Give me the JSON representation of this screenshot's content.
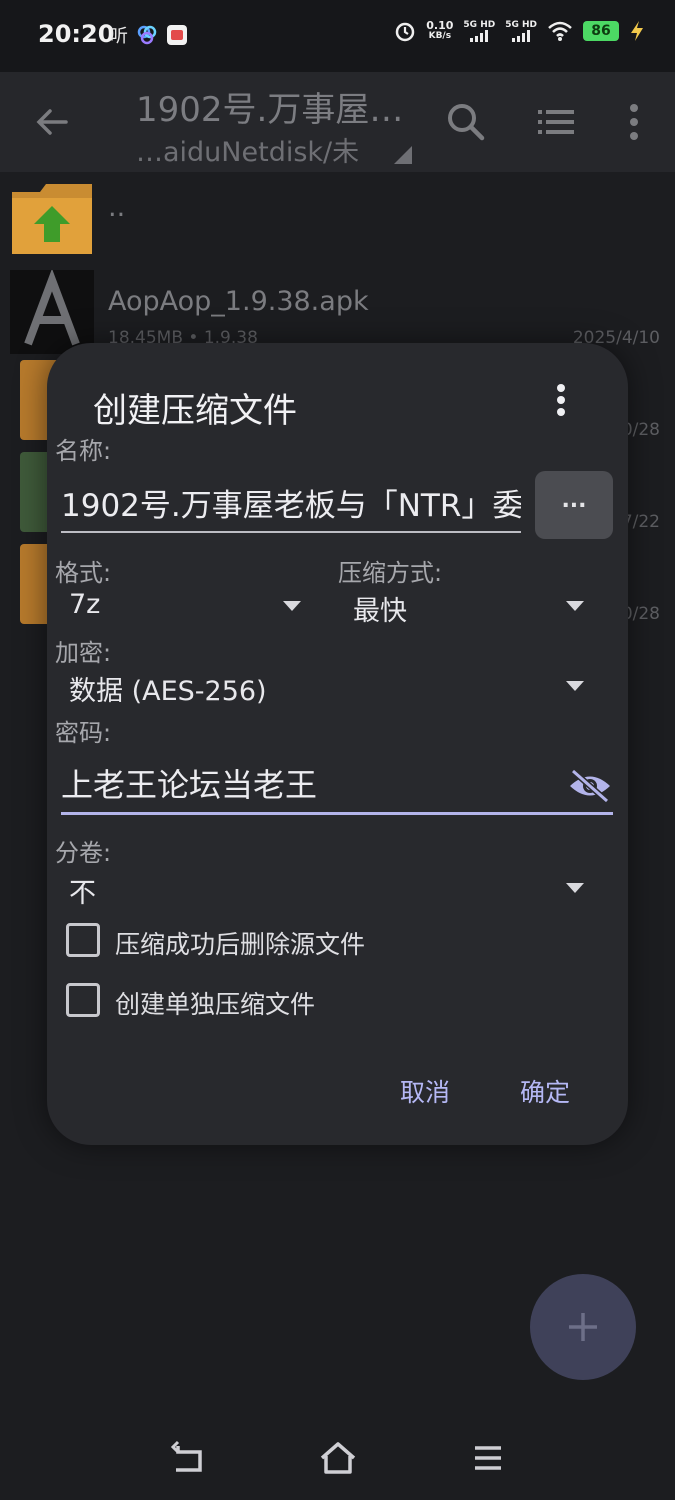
{
  "status_bar": {
    "time": "20:20",
    "speed_top": "0.10",
    "speed_unit": "KB/s",
    "sig1_label": "5G HD",
    "sig2_label": "5G HD",
    "battery": "86",
    "icons": [
      "listen-app-icon",
      "baidu-netdisk-icon",
      "app-icon",
      "alarm-icon",
      "wifi-icon",
      "charging-icon"
    ]
  },
  "toolbar": {
    "title": "1902号.万事屋…",
    "path": "…aiduNetdisk/未"
  },
  "files": [
    {
      "name": "..",
      "meta": "",
      "date": ""
    },
    {
      "name": "AopAop_1.9.38.apk",
      "meta": "18.45MB   • 1.9.38",
      "date": "2025/4/10"
    }
  ],
  "edge_dates": [
    "0/28",
    "7/22",
    "0/28"
  ],
  "dialog": {
    "title": "创建压缩文件",
    "name_label": "名称:",
    "name_value": "1902号.万事屋老板与「NTR」委",
    "browse_label": "...",
    "format_label": "格式:",
    "format_value": "7z",
    "method_label": "压缩方式:",
    "method_value": "最快",
    "encrypt_label": "加密:",
    "encrypt_value": "数据 (AES-256)",
    "password_label": "密码:",
    "password_value": "上老王论坛当老王",
    "split_label": "分卷:",
    "split_value": "不",
    "delete_source_label": "压缩成功后删除源文件",
    "separate_label": "创建单独压缩文件",
    "cancel": "取消",
    "ok": "确定"
  },
  "colors": {
    "accent": "#b5b8f5",
    "dialog_bg": "#28292d",
    "battery": "#4cd964",
    "folder": "#e1a13b",
    "up_arrow": "#3f9c2a"
  }
}
